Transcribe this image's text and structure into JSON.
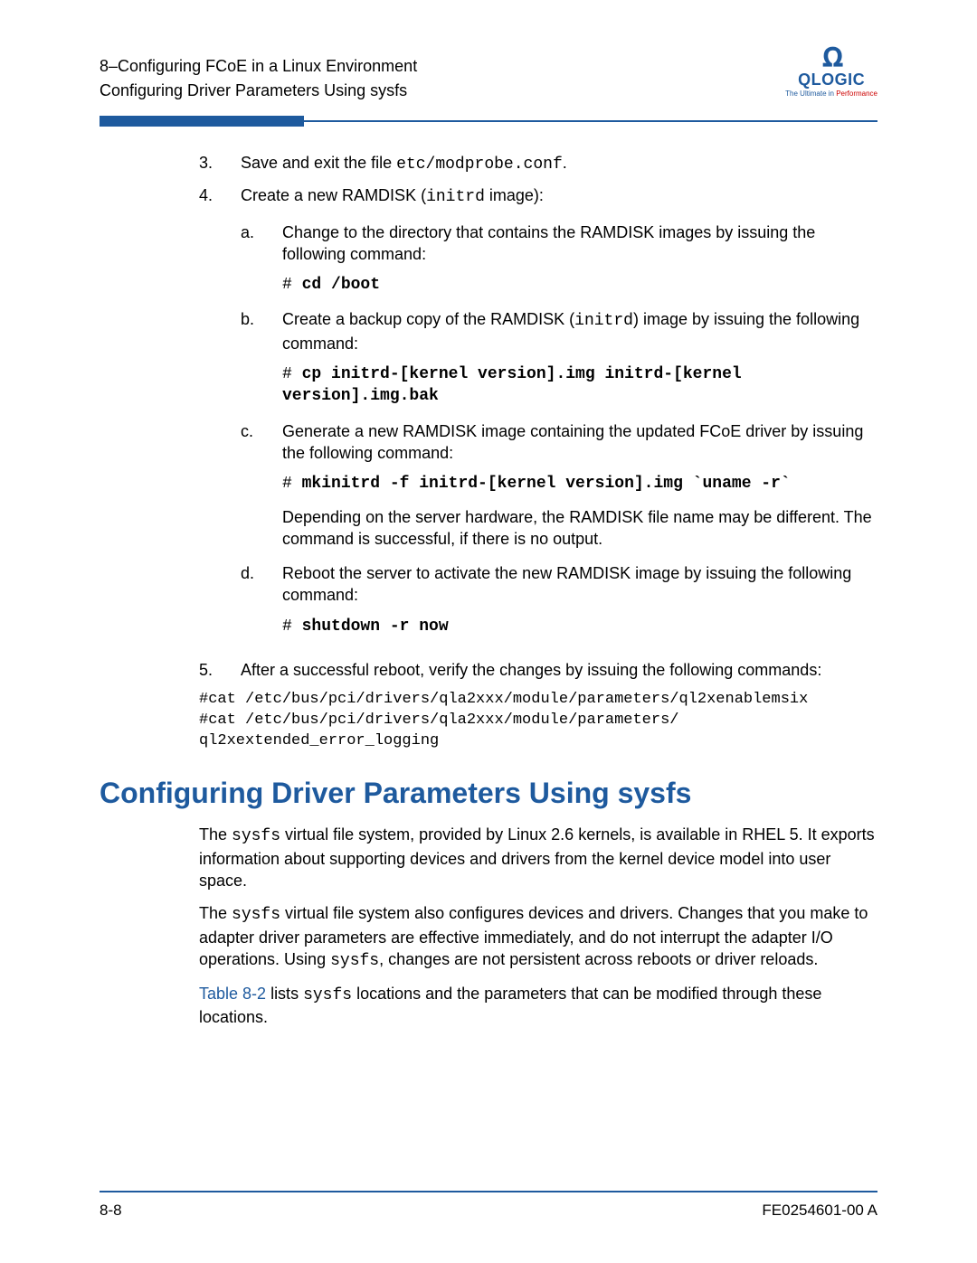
{
  "header": {
    "line1": "8–Configuring FCoE in a Linux Environment",
    "line2": "Configuring Driver Parameters Using sysfs"
  },
  "logo": {
    "brand": "QLOGIC",
    "tagline_pre": "The Ultimate in ",
    "tagline_hl": "Performance"
  },
  "steps": {
    "s3": {
      "num": "3.",
      "text_pre": "Save and exit the file ",
      "code": "etc/modprobe.conf",
      "text_post": "."
    },
    "s4": {
      "num": "4.",
      "text_pre": "Create a new RAMDISK (",
      "code": "initrd",
      "text_post": " image):",
      "a": {
        "letter": "a.",
        "text": "Change to the directory that contains the RAMDISK images by issuing the following command:",
        "cmd_prefix": "# ",
        "cmd": "cd /boot"
      },
      "b": {
        "letter": "b.",
        "text_pre": "Create a backup copy of the RAMDISK (",
        "code": "initrd",
        "text_post": ") image by issuing the following command:",
        "cmd_prefix": "# ",
        "cmd": "cp initrd-[kernel version].img initrd-[kernel version].img.bak"
      },
      "c": {
        "letter": "c.",
        "text": "Generate a new RAMDISK image containing the updated FCoE driver by issuing the following command:",
        "cmd_prefix": "# ",
        "cmd": "mkinitrd -f initrd-[kernel version].img `uname -r`",
        "note": "Depending on the server hardware, the RAMDISK file name may be different. The command is successful, if there is no output."
      },
      "d": {
        "letter": "d.",
        "text": "Reboot the server to activate the new RAMDISK image by issuing the following command:",
        "cmd_prefix": "# ",
        "cmd": "shutdown -r now"
      }
    },
    "s5": {
      "num": "5.",
      "text": "After a successful reboot, verify the changes by issuing the following commands:",
      "cmd1_prefix": "#",
      "cmd1": "cat /etc/bus/pci/drivers/qla2xxx/module/parameters/ql2xenablemsix",
      "cmd2_prefix": "#",
      "cmd2": "cat /etc/bus/pci/drivers/qla2xxx/module/parameters/ ql2xextended_error_logging"
    }
  },
  "section": {
    "heading": "Configuring Driver Parameters Using sysfs",
    "p1_pre": "The ",
    "p1_code": "sysfs",
    "p1_post": " virtual file system, provided by Linux 2.6 kernels, is available in RHEL 5. It exports information about supporting devices and drivers from the kernel device model into user space.",
    "p2_a": "The ",
    "p2_code1": "sysfs",
    "p2_b": " virtual file system also configures devices and drivers. Changes that you make to adapter driver parameters are effective immediately, and do not interrupt the adapter I/O operations. Using ",
    "p2_code2": "sysfs",
    "p2_c": ", changes are not persistent across reboots or driver reloads.",
    "p3_link": "Table 8-2",
    "p3_a": " lists ",
    "p3_code": "sysfs",
    "p3_b": " locations and the parameters that can be modified through these locations."
  },
  "footer": {
    "left": "8-8",
    "right": "FE0254601-00 A"
  }
}
